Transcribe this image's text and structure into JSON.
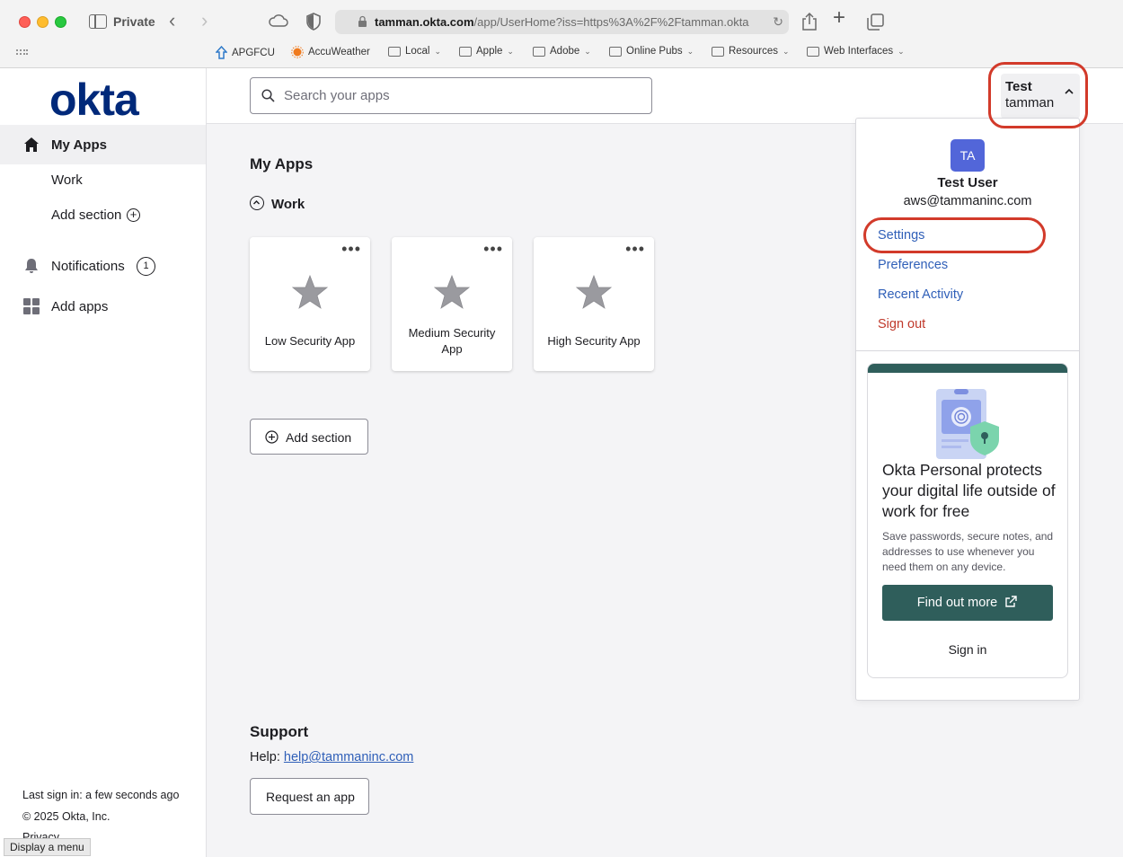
{
  "browser": {
    "private_label": "Private",
    "url_host": "tamman.okta.com",
    "url_rest": "/app/UserHome?iss=https%3A%2F%2Ftamman.okta",
    "bookmarks": [
      "APGFCU",
      "AccuWeather",
      "Local",
      "Apple",
      "Adobe",
      "Online Pubs",
      "Resources",
      "Web Interfaces"
    ]
  },
  "sidebar": {
    "logo": "okta",
    "items": [
      {
        "label": "My Apps"
      },
      {
        "label": "Work"
      },
      {
        "label": "Add section"
      },
      {
        "label": "Notifications",
        "badge": "1"
      },
      {
        "label": "Add apps"
      }
    ],
    "footer": {
      "last_sign_in": "Last sign in: a few seconds ago",
      "copyright": "© 2025 Okta, Inc.",
      "privacy": "Privacy"
    },
    "tooltip": "Display a menu"
  },
  "header": {
    "search_placeholder": "Search your apps",
    "user_first": "Test",
    "user_name": "tamman"
  },
  "main": {
    "title": "My Apps",
    "section": "Work",
    "apps": [
      {
        "name": "Low Security App"
      },
      {
        "name": "Medium Security App"
      },
      {
        "name": "High Security App"
      }
    ],
    "add_section": "Add section",
    "support_title": "Support",
    "help_label": "Help:",
    "help_email": "help@tammaninc.com",
    "request_app": "Request an app"
  },
  "dropdown": {
    "initials": "TA",
    "name": "Test User",
    "email": "aws@tammaninc.com",
    "links": [
      "Settings",
      "Preferences",
      "Recent Activity",
      "Sign out"
    ],
    "promo": {
      "title": "Okta Personal protects your digital life outside of work for free",
      "text": "Save passwords, secure notes, and addresses to use whenever you need them on any device.",
      "button": "Find out more",
      "sign_in": "Sign in"
    }
  },
  "colors": {
    "okta_blue": "#00297a",
    "link_blue": "#2f5fb8",
    "annotation_red": "#d23a2a",
    "promo_green": "#2f5e5b",
    "avatar_blue": "#5266d9"
  }
}
